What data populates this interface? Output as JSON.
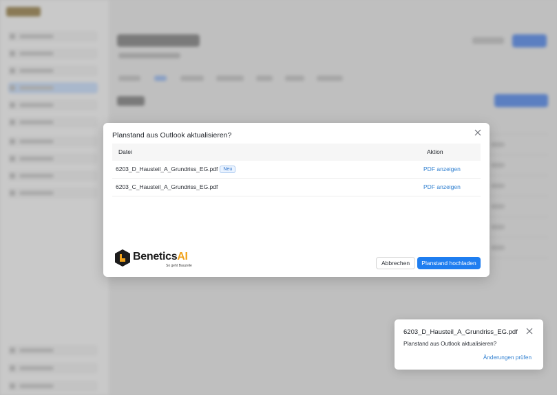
{
  "dialog": {
    "title": "Planstand aus Outlook aktualisieren?",
    "close_icon": "close-icon",
    "columns": {
      "file": "Datei",
      "action": "Aktion"
    },
    "rows": [
      {
        "file": "6203_D_Hausteil_A_Grundriss_EG.pdf",
        "badge": "Neu",
        "action": "PDF anzeigen"
      },
      {
        "file": "6203_C_Hausteil_A_Grundriss_EG.pdf",
        "badge": "",
        "action": "PDF anzeigen"
      }
    ],
    "logo": {
      "name_part1": "Benetics",
      "name_part2": "AI",
      "tagline": "So geht Bauzeile",
      "icon": "benetics-logo-icon"
    },
    "buttons": {
      "cancel": "Abbrechen",
      "upload": "Planstand hochladen"
    },
    "colors": {
      "primary": "#1f7ef0",
      "link": "#2f7fd0",
      "badge_bg": "#eaf3ff",
      "logo_accent": "#f0a21a"
    }
  },
  "toast": {
    "title": "6203_D_Hausteil_A_Grundriss_EG.pdf",
    "message": "Planstand aus Outlook aktualisieren?",
    "link": "Änderungen prüfen",
    "close_icon": "close-icon"
  }
}
